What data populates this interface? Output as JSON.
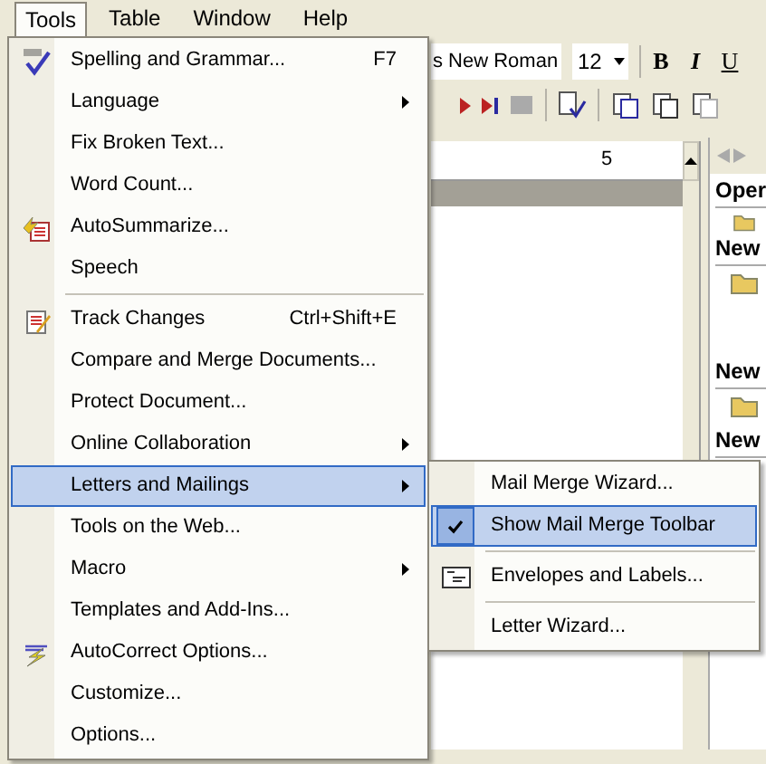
{
  "menu_bar": [
    {
      "label": "Tools",
      "selected": true
    },
    {
      "label": "Table",
      "selected": false
    },
    {
      "label": "Window",
      "selected": false
    },
    {
      "label": "Help",
      "selected": false
    }
  ],
  "toolbar": {
    "font_field": "s New Roman",
    "size_field": "12",
    "format_buttons": [
      "B",
      "I",
      "U"
    ]
  },
  "ruler": {
    "label": "5"
  },
  "task_pane": {
    "headings": [
      "Oper",
      "New",
      "New",
      "New"
    ]
  },
  "tools_menu": {
    "items": [
      {
        "kind": "item",
        "label": "Spelling and Grammar...",
        "shortcut": "F7",
        "submenu": false,
        "selected": false
      },
      {
        "kind": "item",
        "label": "Language",
        "submenu": true,
        "selected": false
      },
      {
        "kind": "item",
        "label": "Fix Broken Text...",
        "submenu": false,
        "selected": false
      },
      {
        "kind": "item",
        "label": "Word Count...",
        "submenu": false,
        "selected": false
      },
      {
        "kind": "item",
        "label": "AutoSummarize...",
        "submenu": false,
        "selected": false
      },
      {
        "kind": "item",
        "label": "Speech",
        "submenu": false,
        "selected": false
      },
      {
        "kind": "separator"
      },
      {
        "kind": "item",
        "label": "Track Changes",
        "shortcut": "Ctrl+Shift+E",
        "submenu": false,
        "selected": false
      },
      {
        "kind": "item",
        "label": "Compare and Merge Documents...",
        "submenu": false,
        "selected": false
      },
      {
        "kind": "item",
        "label": "Protect Document...",
        "submenu": false,
        "selected": false
      },
      {
        "kind": "item",
        "label": "Online Collaboration",
        "submenu": true,
        "selected": false
      },
      {
        "kind": "item",
        "label": "Letters and Mailings",
        "submenu": true,
        "selected": true
      },
      {
        "kind": "item",
        "label": "Tools on the Web...",
        "submenu": false,
        "selected": false
      },
      {
        "kind": "item",
        "label": "Macro",
        "submenu": true,
        "selected": false
      },
      {
        "kind": "item",
        "label": "Templates and Add-Ins...",
        "submenu": false,
        "selected": false
      },
      {
        "kind": "item",
        "label": "AutoCorrect Options...",
        "submenu": false,
        "selected": false
      },
      {
        "kind": "item",
        "label": "Customize...",
        "submenu": false,
        "selected": false
      },
      {
        "kind": "item",
        "label": "Options...",
        "submenu": false,
        "selected": false
      }
    ]
  },
  "mailings_submenu": {
    "items": [
      {
        "kind": "item",
        "label": "Mail Merge Wizard...",
        "checked": false,
        "selected": false
      },
      {
        "kind": "item",
        "label": "Show Mail Merge Toolbar",
        "checked": true,
        "selected": true
      },
      {
        "kind": "separator"
      },
      {
        "kind": "item",
        "label": "Envelopes and Labels...",
        "checked": false,
        "selected": false
      },
      {
        "kind": "separator"
      },
      {
        "kind": "item",
        "label": "Letter Wizard...",
        "checked": false,
        "selected": false
      }
    ]
  }
}
